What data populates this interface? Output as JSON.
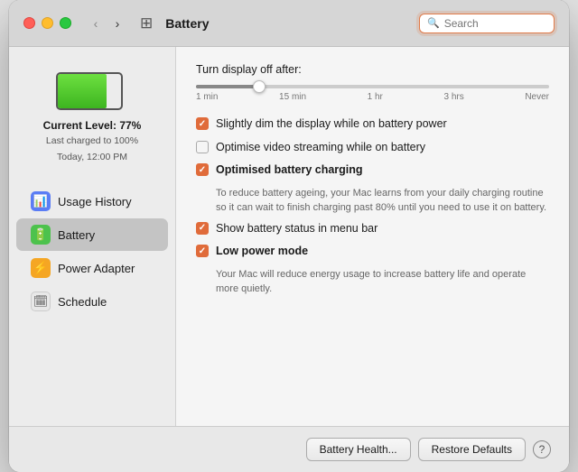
{
  "window": {
    "title": "Battery"
  },
  "titlebar": {
    "back_arrow": "‹",
    "forward_arrow": "›",
    "grid_icon": "⊞",
    "search_placeholder": "Search"
  },
  "sidebar": {
    "battery_level_label": "Current Level: 77%",
    "battery_charged_label": "Last charged to 100%",
    "battery_time_label": "Today, 12:00 PM",
    "items": [
      {
        "id": "usage-history",
        "label": "Usage History",
        "icon": "📊",
        "active": false
      },
      {
        "id": "battery",
        "label": "Battery",
        "icon": "🔋",
        "active": true
      },
      {
        "id": "power-adapter",
        "label": "Power Adapter",
        "icon": "⚡",
        "active": false
      },
      {
        "id": "schedule",
        "label": "Schedule",
        "icon": "🗓",
        "active": false
      }
    ]
  },
  "main": {
    "display_off_label": "Turn display off after:",
    "slider_labels": [
      "1 min",
      "15 min",
      "1 hr",
      "3 hrs",
      "Never"
    ],
    "options": [
      {
        "id": "dim-display",
        "label": "Slightly dim the display while on battery power",
        "checked": true,
        "description": ""
      },
      {
        "id": "video-streaming",
        "label": "Optimise video streaming while on battery",
        "checked": false,
        "description": ""
      },
      {
        "id": "optimised-charging",
        "label": "Optimised battery charging",
        "checked": true,
        "description": "To reduce battery ageing, your Mac learns from your daily charging routine so it can wait to finish charging past 80% until you need to use it on battery."
      },
      {
        "id": "menu-bar",
        "label": "Show battery status in menu bar",
        "checked": true,
        "description": ""
      },
      {
        "id": "low-power",
        "label": "Low power mode",
        "checked": true,
        "description": "Your Mac will reduce energy usage to increase battery life and operate more quietly."
      }
    ]
  },
  "bottom": {
    "health_button": "Battery Health...",
    "restore_button": "Restore Defaults",
    "help_icon": "?"
  }
}
